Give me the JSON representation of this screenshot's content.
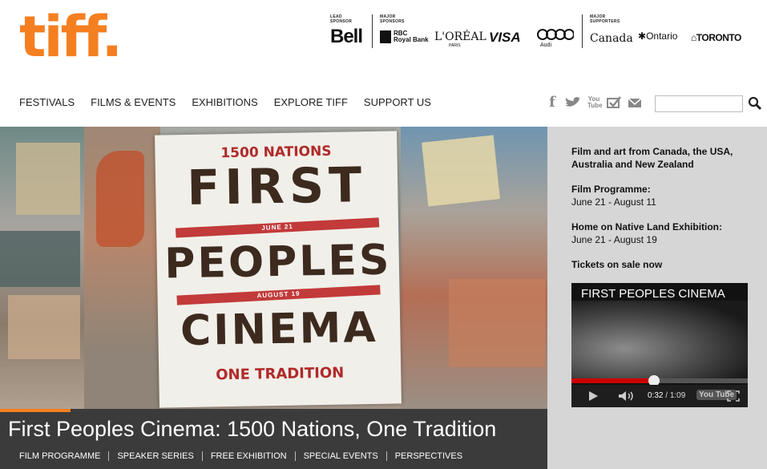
{
  "logo": {
    "text": "tiff."
  },
  "sponsors": {
    "lead_label": "LEAD SPONSOR",
    "major_label": "MAJOR SPONSORS",
    "supporters_label": "MAJOR SUPPORTERS",
    "bell": "Bell",
    "rbc": "RBC",
    "rbc_sub": "Royal Bank",
    "loreal": "L'ORÉAL",
    "loreal_sub": "PARIS",
    "visa": "VISA",
    "audi": "Audi",
    "canada": "Canada",
    "ontario": "Ontario",
    "toronto": "TORONTO"
  },
  "nav": {
    "items": [
      "FESTIVALS",
      "FILMS & EVENTS",
      "EXHIBITIONS",
      "EXPLORE TIFF",
      "SUPPORT US"
    ]
  },
  "social": {
    "facebook": "f",
    "twitter": "t",
    "youtube": "You Tube",
    "checkin": "✓",
    "email": "✉"
  },
  "search": {
    "placeholder": ""
  },
  "hero": {
    "poster_top": "1500 NATIONS",
    "poster_first": "FIRST",
    "poster_date1": "JUNE 21",
    "poster_peoples": "PEOPLES",
    "poster_date2": "AUGUST 19",
    "poster_cinema": "CINEMA",
    "poster_bottom": "ONE TRADITION",
    "caption": "First Peoples Cinema: 1500 Nations, One Tradition"
  },
  "sub_nav": [
    "FILM PROGRAMME",
    "SPEAKER SERIES",
    "FREE EXHIBITION",
    "SPECIAL EVENTS",
    "PERSPECTIVES"
  ],
  "side": {
    "intro": "Film and art from Canada, the USA, Australia and New Zealand",
    "film_label": "Film Programme:",
    "film_dates": "June 21 - August 11",
    "home_label": "Home on Native Land Exhibition:",
    "home_dates": "June 21 - August 19",
    "tickets": "Tickets on sale now"
  },
  "video": {
    "title": "FIRST PEOPLES CINEMA",
    "current": "0:32",
    "separator": " / ",
    "duration": "1:09",
    "progress": 0.47,
    "youtube": "You Tube"
  },
  "colors": {
    "brand": "#f47f20",
    "caption_bg": "#3b3b3b",
    "side_bg": "#d6d6d6"
  }
}
